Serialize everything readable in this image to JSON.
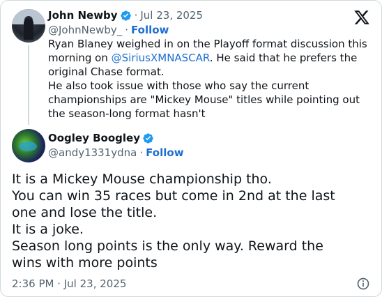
{
  "quoted_tweet": {
    "author_name": "John Newby",
    "date": "Jul 23, 2025",
    "handle": "@JohnNewby_",
    "follow_label": "Follow",
    "text_part1": "Ryan Blaney weighed in on the Playoff format discussion this",
    "text_part2_prefix": "morning on ",
    "mention": "@SiriusXMNASCAR",
    "text_part2_suffix": ". He said that he prefers the",
    "text_part3": "original Chase format.",
    "text_part4": "He also took issue with those who say the current",
    "text_part5": "championships are \"Mickey Mouse\" titles while pointing out",
    "text_part6": "the season-long format hasn't"
  },
  "reply_tweet": {
    "author_name": "Oogley Boogley",
    "handle": "@andy1331ydna",
    "follow_label": "Follow",
    "lines": [
      "It is a Mickey Mouse championship tho.",
      "You can win 35 races but come in 2nd at the last",
      "one and lose the title.",
      "It is a joke.",
      "Season long points is the only way. Reward the",
      "wins with more points"
    ],
    "timestamp": "2:36 PM · Jul 23, 2025"
  },
  "colors": {
    "link": "#1d6fd1",
    "secondary_text": "#536471",
    "verified_badge": "#1d9bf0",
    "border": "#cfd9de"
  },
  "icons": {
    "brand": "x-logo-icon",
    "verified": "verified-badge-icon",
    "info": "info-icon"
  }
}
